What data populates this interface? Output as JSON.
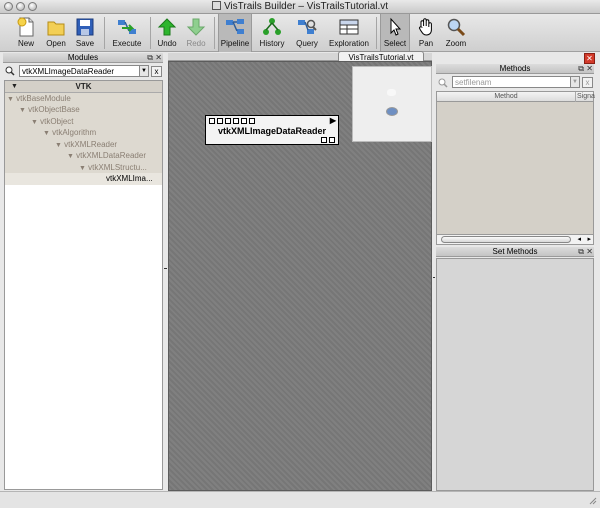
{
  "window": {
    "title": "VisTrails Builder – VisTrailsTutorial.vt"
  },
  "toolbar": {
    "new": "New",
    "open": "Open",
    "save": "Save",
    "execute": "Execute",
    "undo": "Undo",
    "redo": "Redo",
    "pipeline": "Pipeline",
    "history": "History",
    "query": "Query",
    "exploration": "Exploration",
    "select": "Select",
    "pan": "Pan",
    "zoom": "Zoom"
  },
  "modules_panel": {
    "title": "Modules",
    "search_value": "vtkXMLImageDataReader",
    "clear": "x",
    "tree": [
      {
        "label": "VTK",
        "level": 0,
        "type": "header"
      },
      {
        "label": "vtkBaseModule",
        "level": 0
      },
      {
        "label": "vtkObjectBase",
        "level": 1
      },
      {
        "label": "vtkObject",
        "level": 2
      },
      {
        "label": "vtkAlgorithm",
        "level": 3
      },
      {
        "label": "vtkXMLReader",
        "level": 4
      },
      {
        "label": "vtkXMLDataReader",
        "level": 5
      },
      {
        "label": "vtkXMLStructu...",
        "level": 6
      },
      {
        "label": "vtkXMLIma...",
        "level": 7
      }
    ]
  },
  "canvas": {
    "tab_label": "VisTrailsTutorial.vt",
    "module_name": "vtkXMLImageDataReader"
  },
  "methods_panel": {
    "title": "Methods",
    "search_placeholder": "setfilenam",
    "clear": "x",
    "col_method": "Method",
    "col_signature": "Signa"
  },
  "set_methods_panel": {
    "title": "Set Methods"
  },
  "colors": {
    "canvas_bg": "#7b7b7b",
    "tree_highlight": "#ddd9d0",
    "close_red": "#d23a2a"
  }
}
